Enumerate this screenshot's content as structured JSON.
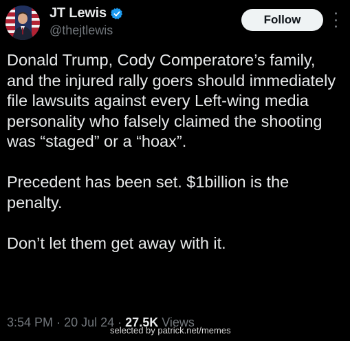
{
  "author": {
    "display_name": "JT Lewis",
    "handle": "@thejtlewis",
    "verified": true
  },
  "actions": {
    "follow_label": "Follow"
  },
  "tweet": {
    "paragraphs": [
      "Donald Trump, Cody Comperatore’s family, and the injured rally goers should immediately file lawsuits against every Left-wing media personality who falsely claimed the shooting was “staged” or a “hoax”.",
      "Precedent has been set. $1billion is the penalty.",
      "Don’t let them get away with it."
    ],
    "time": "3:54 PM",
    "separator": "·",
    "date": "20 Jul 24",
    "views_count": "27.5K",
    "views_label": "Views"
  },
  "overlay": {
    "watermark": "selected by patrick.net/memes"
  },
  "colors": {
    "background": "#000000",
    "primary_text": "#e7e9ea",
    "secondary_text": "#71767b",
    "verified": "#1d9bf0",
    "follow_bg": "#eff3f4"
  },
  "icons": {
    "verified": "verified-badge-icon",
    "more": "more-vertical-icon"
  }
}
